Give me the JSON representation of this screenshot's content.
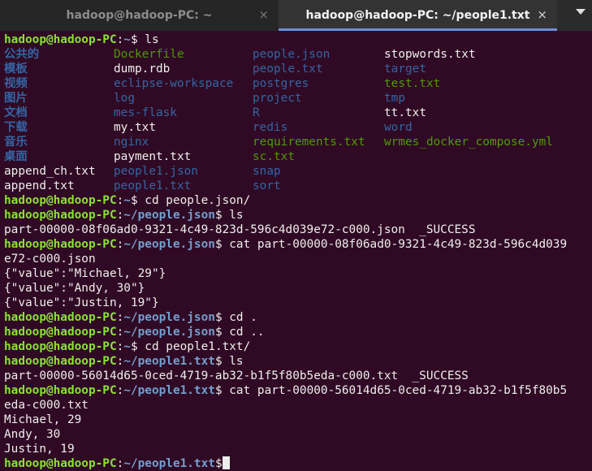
{
  "tabs": [
    {
      "title": "hadoop@hadoop-PC: ~",
      "close": "×"
    },
    {
      "title": "hadoop@hadoop-PC: ~/people1.txt",
      "close": "×"
    }
  ],
  "prompt": {
    "userhost": "hadoop@hadoop-PC",
    "sep": ":",
    "dollar": "$"
  },
  "ls_columns": [
    [
      {
        "text": "公共的",
        "kind": "cjk"
      },
      {
        "text": "模板",
        "kind": "cjk"
      },
      {
        "text": "视频",
        "kind": "cjk"
      },
      {
        "text": "图片",
        "kind": "cjk"
      },
      {
        "text": "文档",
        "kind": "cjk"
      },
      {
        "text": "下载",
        "kind": "cjk"
      },
      {
        "text": "音乐",
        "kind": "cjk"
      },
      {
        "text": "桌面",
        "kind": "cjk"
      },
      {
        "text": "append_ch.txt",
        "kind": "file"
      },
      {
        "text": "append.txt",
        "kind": "file"
      }
    ],
    [
      {
        "text": "Dockerfile",
        "kind": "green"
      },
      {
        "text": "dump.rdb",
        "kind": "file"
      },
      {
        "text": "eclipse-workspace",
        "kind": "dir"
      },
      {
        "text": "log",
        "kind": "dir"
      },
      {
        "text": "mes-flask",
        "kind": "dir"
      },
      {
        "text": "my.txt",
        "kind": "file"
      },
      {
        "text": "nginx",
        "kind": "dir"
      },
      {
        "text": "payment.txt",
        "kind": "file"
      },
      {
        "text": "people1.json",
        "kind": "dir"
      },
      {
        "text": "people1.txt",
        "kind": "dir"
      }
    ],
    [
      {
        "text": "people.json",
        "kind": "dir"
      },
      {
        "text": "people.txt",
        "kind": "dir"
      },
      {
        "text": "postgres",
        "kind": "dir"
      },
      {
        "text": "project",
        "kind": "dir"
      },
      {
        "text": "R",
        "kind": "dir"
      },
      {
        "text": "redis",
        "kind": "dir"
      },
      {
        "text": "requirements.txt",
        "kind": "green"
      },
      {
        "text": "sc.txt",
        "kind": "green"
      },
      {
        "text": "snap",
        "kind": "dir"
      },
      {
        "text": "sort",
        "kind": "dir"
      }
    ],
    [
      {
        "text": "stopwords.txt",
        "kind": "file"
      },
      {
        "text": "target",
        "kind": "dir"
      },
      {
        "text": "test.txt",
        "kind": "green"
      },
      {
        "text": "tmp",
        "kind": "dir"
      },
      {
        "text": "tt.txt",
        "kind": "file"
      },
      {
        "text": "word",
        "kind": "dir"
      },
      {
        "text": "wrmes_docker_compose.yml",
        "kind": "green"
      }
    ]
  ],
  "lines": [
    {
      "type": "prompt",
      "path": "~",
      "cmd": " ls"
    },
    {
      "type": "ls"
    },
    {
      "type": "prompt",
      "path": "~",
      "cmd": " cd people.json/"
    },
    {
      "type": "prompt",
      "path": "~/people.json",
      "cmd": " ls"
    },
    {
      "type": "out",
      "text": "part-00000-08f06ad0-9321-4c49-823d-596c4d039e72-c000.json  _SUCCESS"
    },
    {
      "type": "prompt",
      "path": "~/people.json",
      "cmd": " cat part-00000-08f06ad0-9321-4c49-823d-596c4d039"
    },
    {
      "type": "out",
      "text": "e72-c000.json"
    },
    {
      "type": "out",
      "text": "{\"value\":\"Michael, 29\"}"
    },
    {
      "type": "out",
      "text": "{\"value\":\"Andy, 30\"}"
    },
    {
      "type": "out",
      "text": "{\"value\":\"Justin, 19\"}"
    },
    {
      "type": "prompt",
      "path": "~/people.json",
      "cmd": " cd ."
    },
    {
      "type": "prompt",
      "path": "~/people.json",
      "cmd": " cd .."
    },
    {
      "type": "prompt",
      "path": "~",
      "cmd": " cd people1.txt/"
    },
    {
      "type": "prompt",
      "path": "~/people1.txt",
      "cmd": " ls"
    },
    {
      "type": "out",
      "text": "part-00000-56014d65-0ced-4719-ab32-b1f5f80b5eda-c000.txt  _SUCCESS"
    },
    {
      "type": "prompt",
      "path": "~/people1.txt",
      "cmd": " cat part-00000-56014d65-0ced-4719-ab32-b1f5f80b5"
    },
    {
      "type": "out",
      "text": "eda-c000.txt"
    },
    {
      "type": "out",
      "text": "Michael, 29"
    },
    {
      "type": "out",
      "text": "Andy, 30"
    },
    {
      "type": "out",
      "text": "Justin, 19"
    },
    {
      "type": "prompt",
      "path": "~/people1.txt",
      "cmd": "",
      "cursor": true
    }
  ],
  "colors": {
    "background": "#300a24",
    "prompt_user": "#8ae234",
    "prompt_path": "#729fcf",
    "dir": "#3465a4",
    "exec": "#4e9a06"
  }
}
